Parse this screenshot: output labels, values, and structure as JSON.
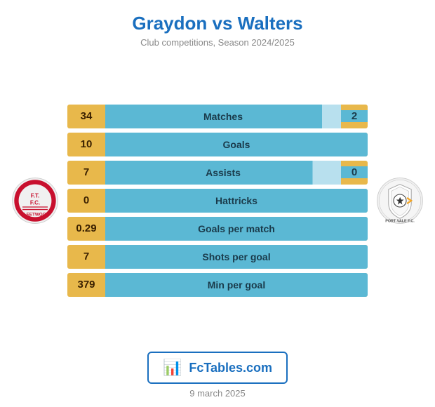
{
  "header": {
    "title": "Graydon vs Walters",
    "subtitle": "Club competitions, Season 2024/2025"
  },
  "stats": [
    {
      "label": "Matches",
      "left": "34",
      "right": "2",
      "has_right": true,
      "row_class": "matches-row"
    },
    {
      "label": "Goals",
      "left": "10",
      "right": "",
      "has_right": false,
      "row_class": "no-right"
    },
    {
      "label": "Assists",
      "left": "7",
      "right": "0",
      "has_right": true,
      "row_class": "assists-row"
    },
    {
      "label": "Hattricks",
      "left": "0",
      "right": "",
      "has_right": false,
      "row_class": "no-right"
    },
    {
      "label": "Goals per match",
      "left": "0.29",
      "right": "",
      "has_right": false,
      "row_class": "no-right"
    },
    {
      "label": "Shots per goal",
      "left": "7",
      "right": "",
      "has_right": false,
      "row_class": "no-right"
    },
    {
      "label": "Min per goal",
      "left": "379",
      "right": "",
      "has_right": false,
      "row_class": "no-right"
    }
  ],
  "fctables": {
    "text": "FcTables.com"
  },
  "footer": {
    "date": "9 march 2025"
  }
}
